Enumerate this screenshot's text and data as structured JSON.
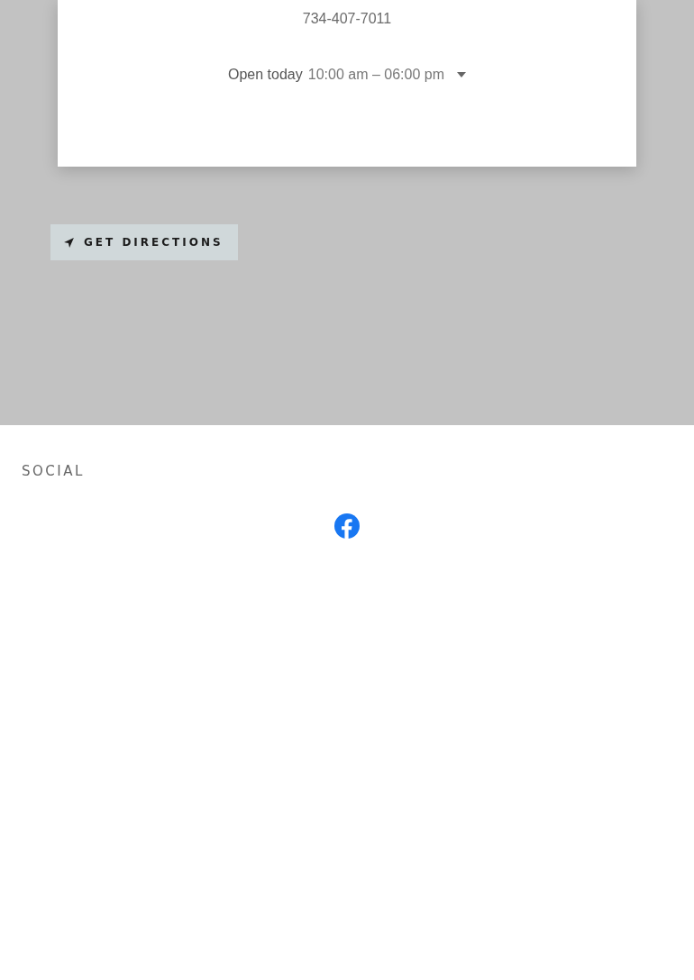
{
  "contact_card": {
    "phone": "734-407-7011",
    "hours_label": "Open today",
    "hours": "10:00 am – 06:00 pm"
  },
  "directions_button": {
    "label": "GET DIRECTIONS"
  },
  "social": {
    "heading": "SOCIAL",
    "links": [
      {
        "kind": "facebook"
      }
    ]
  }
}
